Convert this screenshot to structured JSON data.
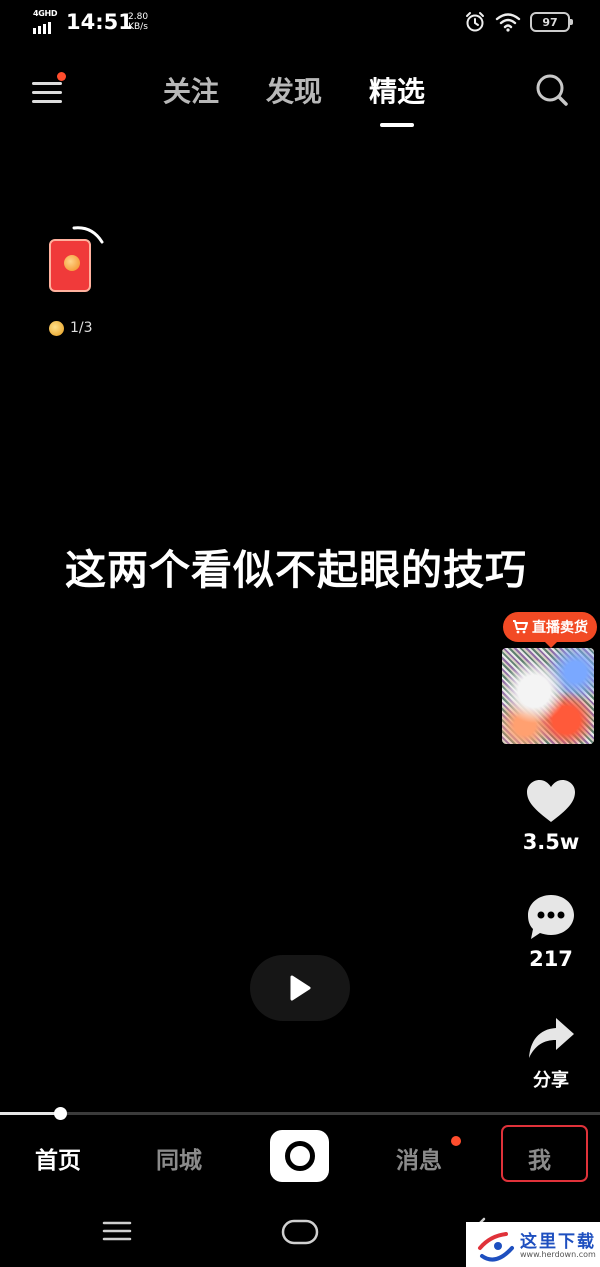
{
  "status_bar": {
    "network": "4GHD",
    "time": "14:51",
    "speed_value": "2.80",
    "speed_unit": "KB/s",
    "battery": "97",
    "icons": [
      "alarm-icon",
      "wifi-icon"
    ]
  },
  "top_nav": {
    "menu_icon": "hamburger-menu-icon",
    "tabs": [
      {
        "label": "关注",
        "active": false
      },
      {
        "label": "发现",
        "active": false
      },
      {
        "label": "精选",
        "active": true
      }
    ],
    "search_icon": "search-icon"
  },
  "red_envelope": {
    "icon": "red-envelope-icon",
    "progress_text": "1/3",
    "progress_fraction": 0.333
  },
  "video": {
    "caption": "这两个看似不起眼的技巧",
    "progress_fraction": 0.1
  },
  "right_rail": {
    "live_label": "直播卖货",
    "likes": "3.5w",
    "comments": "217",
    "share_label": "分享"
  },
  "tab_bar": {
    "home": "首页",
    "city": "同城",
    "messages": "消息",
    "me": "我",
    "messages_has_dot": true
  },
  "watermark": {
    "title": "这里下载",
    "url": "www.herdown.com"
  },
  "colors": {
    "accent": "#f24a24",
    "badge_dot": "#ff4d2d",
    "highlight_box": "#e0323a",
    "background": "#000000"
  }
}
